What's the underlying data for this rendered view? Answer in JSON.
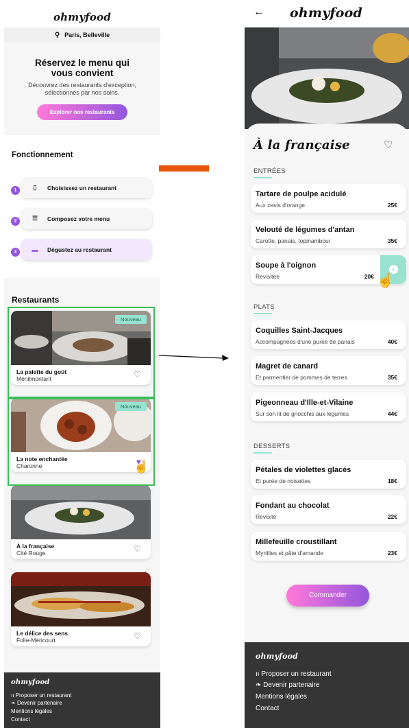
{
  "left": {
    "logo": "ohmyfood",
    "location": "Paris, Belleville",
    "hero": {
      "title": "Réservez le menu qui vous convient",
      "subtitle": "Découvrez des restaurants d'exception, sélectionnés par nos soins.",
      "button": "Explorer nos restaurants"
    },
    "howto": {
      "title": "Fonctionnement",
      "steps": [
        {
          "num": "1",
          "label": "Choisissez un restaurant",
          "icon": "phone-icon"
        },
        {
          "num": "2",
          "label": "Composez votre menu",
          "icon": "list-icon"
        },
        {
          "num": "3",
          "label": "Dégustez au restaurant",
          "icon": "tray-icon"
        }
      ]
    },
    "restaurants": {
      "title": "Restaurants",
      "badge": "Nouveau",
      "items": [
        {
          "name": "La palette du goût",
          "area": "Ménilmontant"
        },
        {
          "name": "La note enchantée",
          "area": "Charonne"
        },
        {
          "name": "À la française",
          "area": "Cité Rouge"
        },
        {
          "name": "Le délice des sens",
          "area": "Folie-Méricourt"
        }
      ]
    },
    "footer": {
      "logo": "ohmyfood",
      "links": [
        "Proposer un restaurant",
        "Devenir partenaire",
        "Mentions légales",
        "Contact"
      ]
    }
  },
  "right": {
    "logo": "ohmyfood",
    "title": "À la française",
    "sections": [
      {
        "name": "ENTRÉES",
        "dishes": [
          {
            "name": "Tartare de poulpe acidulé",
            "desc": "Aux zests d'orange",
            "price": "25€"
          },
          {
            "name": "Velouté de légumes d'antan",
            "desc": "Carotte, panais, topinambour",
            "price": "35€"
          },
          {
            "name": "Soupe à l'oignon",
            "desc": "Revisitée",
            "price": "20€"
          }
        ]
      },
      {
        "name": "PLATS",
        "dishes": [
          {
            "name": "Coquilles Saint-Jacques",
            "desc": "Accompagnées d'une purée de panais",
            "price": "40€"
          },
          {
            "name": "Magret de canard",
            "desc": "Et parmentier de pommes de terres",
            "price": "35€"
          },
          {
            "name": "Pigeonneau d'Ille-et-Vilaine",
            "desc": "Sur son lit de gnocchis aux légumes",
            "price": "44€"
          }
        ]
      },
      {
        "name": "DESSERTS",
        "dishes": [
          {
            "name": "Pétales de violettes glacés",
            "desc": "Et purée de noisettes",
            "price": "18€"
          },
          {
            "name": "Fondant au chocolat",
            "desc": "Revisité",
            "price": "22€"
          },
          {
            "name": "Millefeuille croustillant",
            "desc": "Myrtilles et pâte d'amande",
            "price": "23€"
          }
        ]
      }
    ],
    "order_button": "Commander",
    "footer": {
      "logo": "ohmyfood",
      "links": [
        "Proposer un restaurant",
        "Devenir partenaire",
        "Mentions légales",
        "Contact"
      ]
    }
  },
  "colors": {
    "accent_purple": "#9356dc",
    "accent_pink": "#ff79da",
    "accent_mint": "#99e2d0",
    "annotation_green": "#3bbd5a",
    "annotation_orange": "#e8580c",
    "footer_bg": "#353535"
  }
}
